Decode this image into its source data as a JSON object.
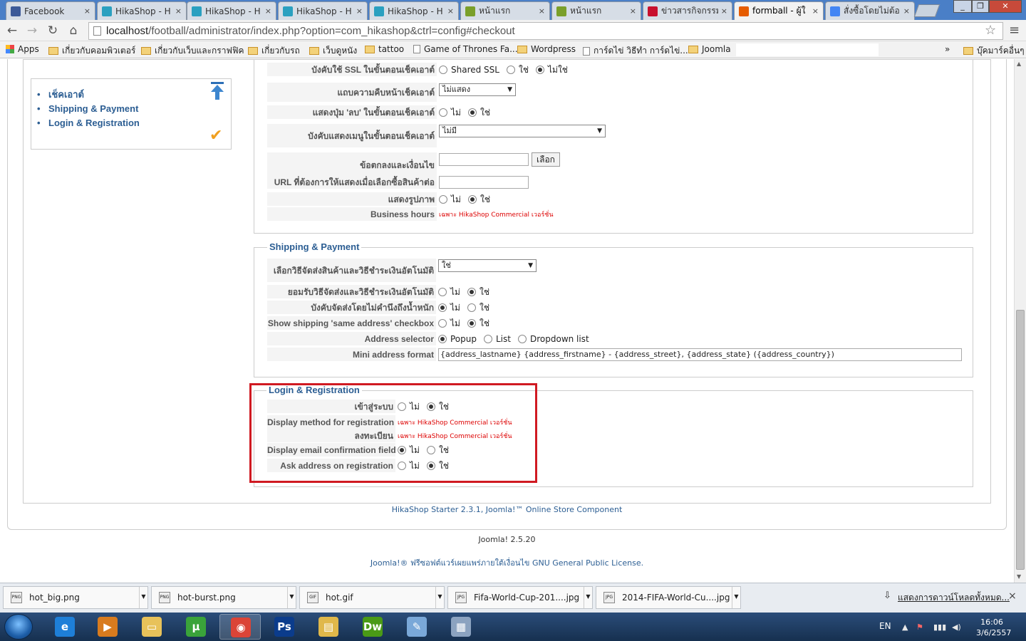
{
  "browser": {
    "tabs": [
      {
        "title": "Facebook",
        "fav": "#3b5998"
      },
      {
        "title": "HikaShop - H",
        "fav": "#2aa0c0"
      },
      {
        "title": "HikaShop - H",
        "fav": "#2aa0c0"
      },
      {
        "title": "HikaShop - H",
        "fav": "#2aa0c0"
      },
      {
        "title": "HikaShop - H",
        "fav": "#2aa0c0"
      },
      {
        "title": "หน้าแรก",
        "fav": "#7a9f2a"
      },
      {
        "title": "หน้าแรก",
        "fav": "#7a9f2a"
      },
      {
        "title": "ข่าวสารกิจกรรม",
        "fav": "#c8102e"
      },
      {
        "title": "formball - ผู้ใ",
        "fav": "#e65c00"
      },
      {
        "title": "สั่งซื้อโดยไม่ต้อ",
        "fav": "#4285f4"
      }
    ],
    "tab_close": "×",
    "url_host": "localhost",
    "url_path": "/football/administrator/index.php?option=com_hikashop&ctrl=config#checkout",
    "bookmarks": [
      {
        "label": "Apps",
        "icon": "apps-icon"
      },
      {
        "label": "เกี่ยวกับคอมพิวเตอร์",
        "icon": "folder-icon"
      },
      {
        "label": "เกี่ยวกับเว็บและกราฟฟิค",
        "icon": "folder-icon"
      },
      {
        "label": "เกี่ยวกับรถ",
        "icon": "folder-icon"
      },
      {
        "label": "เว็บดูหนัง",
        "icon": "folder-icon"
      },
      {
        "label": "tattoo",
        "icon": "folder-icon"
      },
      {
        "label": "Game of Thrones Fa...",
        "icon": "page-icon"
      },
      {
        "label": "Wordpress",
        "icon": "folder-icon"
      },
      {
        "label": "การ์ดไข่ วิธีทำ การ์ดไข่...",
        "icon": "page-icon"
      },
      {
        "label": "Joomla",
        "icon": "folder-icon"
      }
    ],
    "bookmarks_more": "»",
    "other_bookmarks": "บุ๊คมาร์คอื่นๆ"
  },
  "sidebar": {
    "items": [
      "เช็คเอาต์",
      "Shipping & Payment",
      "Login & Registration"
    ]
  },
  "checkout": {
    "rows": [
      {
        "label": "บังคับใช้ SSL ในขั้นตอนเช็คเอาต์",
        "options": [
          "Shared SSL",
          "ใช่",
          "ไม่ใช่"
        ],
        "selected": 2
      },
      {
        "label": "แถบความคืบหน้าเช็คเอาต์",
        "select": "ไม่แสดง"
      },
      {
        "label": "แสดงปุ่ม 'ลบ' ในขั้นตอนเช็คเอาต์",
        "options": [
          "ไม่",
          "ใช่"
        ],
        "selected": 1
      },
      {
        "label": "บังคับแสดงเมนูในขั้นตอนเช็คเอาต์",
        "select": "ไม่มี"
      },
      {
        "label": "ข้อตกลงและเงื่อนไข",
        "input": "",
        "button": "เลือก"
      },
      {
        "label": "URL ที่ต้องการให้แสดงเมื่อเลือกซื้อสินค้าต่อ",
        "input": ""
      },
      {
        "label": "แสดงรูปภาพ",
        "options": [
          "ไม่",
          "ใช่"
        ],
        "selected": 1
      },
      {
        "label": "Business hours",
        "note": "เฉพาะ HikaShop Commercial เวอร์ชั่น"
      }
    ]
  },
  "shipping": {
    "legend": "Shipping & Payment",
    "rows": [
      {
        "label": "เลือกวิธีจัดส่งสินค้าและวิธีชำระเงินอัตโนมัติ",
        "select": "ใช่"
      },
      {
        "label": "ยอมรับวิธีจัดส่งและวิธีชำระเงินอัตโนมัติ",
        "options": [
          "ไม่",
          "ใช่"
        ],
        "selected": 1
      },
      {
        "label": "บังคับจัดส่งโดยไม่คำนึงถึงน้ำหนัก",
        "options": [
          "ไม่",
          "ใช่"
        ],
        "selected": 0
      },
      {
        "label": "Show shipping 'same address' checkbox",
        "options": [
          "ไม่",
          "ใช่"
        ],
        "selected": 1
      },
      {
        "label": "Address selector",
        "options": [
          "Popup",
          "List",
          "Dropdown list"
        ],
        "selected": 0
      },
      {
        "label": "Mini address format",
        "input": "{address_lastname} {address_firstname} - {address_street}, {address_state} ({address_country})"
      }
    ]
  },
  "login": {
    "legend": "Login & Registration",
    "rows": [
      {
        "label": "เข้าสู่ระบบ",
        "options": [
          "ไม่",
          "ใช่"
        ],
        "selected": 1
      },
      {
        "label": "Display method for registration",
        "note": "เฉพาะ HikaShop Commercial เวอร์ชั่น"
      },
      {
        "label": "ลงทะเบียน",
        "note": "เฉพาะ HikaShop Commercial เวอร์ชั่น"
      },
      {
        "label": "Display email confirmation field",
        "options": [
          "ไม่",
          "ใช่"
        ],
        "selected": 0
      },
      {
        "label": "Ask address on registration",
        "options": [
          "ไม่",
          "ใช่"
        ],
        "selected": 1
      }
    ]
  },
  "footer": {
    "component": "HikaShop Starter 2.3.1, Joomla!™ Online Store Component",
    "version": "Joomla! 2.5.20",
    "license_prefix": "Joomla!® ฟรีซอฟต์แวร์เผยแพร่ภายใต้เงื่อนไข",
    "license_link": "GNU General Public License."
  },
  "downloads": {
    "items": [
      {
        "name": "hot_big.png",
        "ext": "PNG"
      },
      {
        "name": "hot-burst.png",
        "ext": "PNG"
      },
      {
        "name": "hot.gif",
        "ext": "GIF"
      },
      {
        "name": "Fifa-World-Cup-201....jpg",
        "ext": "JPG"
      },
      {
        "name": "2014-FIFA-World-Cu....jpg",
        "ext": "JPG"
      }
    ],
    "show_all": "แสดงการดาวน์โหลดทั้งหมด...",
    "close": "×"
  },
  "taskbar": {
    "apps": [
      {
        "name": "internet-explorer",
        "glyph": "e",
        "color": "#1e7fd8"
      },
      {
        "name": "media-player",
        "glyph": "▶",
        "color": "#d87b1e"
      },
      {
        "name": "file-explorer",
        "glyph": "▭",
        "color": "#e8c25a"
      },
      {
        "name": "utorrent",
        "glyph": "µ",
        "color": "#3aa33a"
      },
      {
        "name": "chrome",
        "glyph": "◉",
        "color": "#db4437"
      },
      {
        "name": "photoshop",
        "glyph": "Ps",
        "color": "#0b3c8c"
      },
      {
        "name": "folder",
        "glyph": "▤",
        "color": "#e0b84a"
      },
      {
        "name": "dreamweaver",
        "glyph": "Dw",
        "color": "#4a9a16"
      },
      {
        "name": "paint",
        "glyph": "✎",
        "color": "#7aa8d8"
      },
      {
        "name": "calculator",
        "glyph": "▦",
        "color": "#8ca3c0"
      }
    ],
    "lang": "EN",
    "time": "16:06",
    "date": "3/6/2557"
  }
}
